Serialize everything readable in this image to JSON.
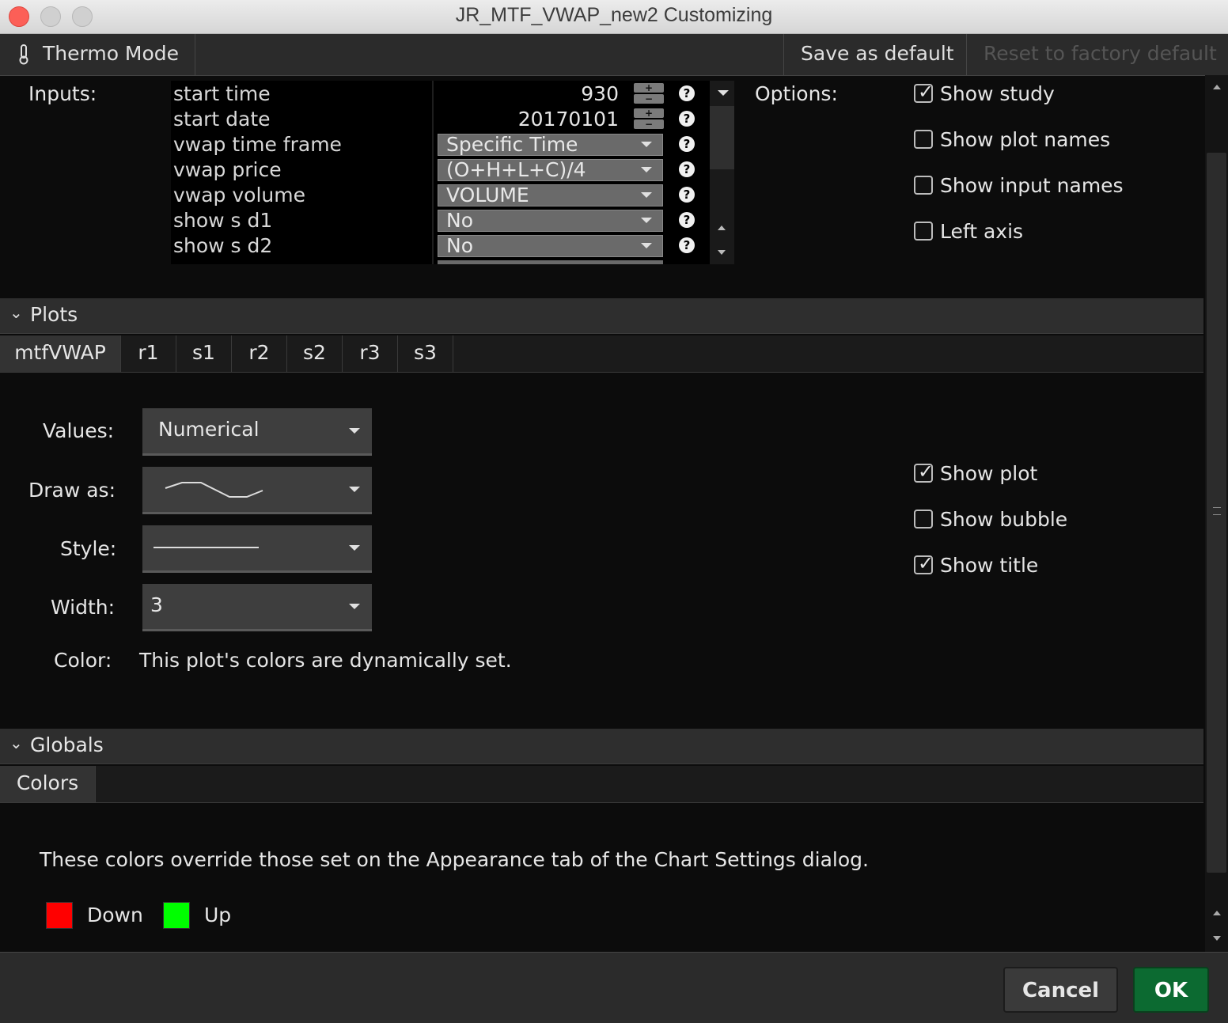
{
  "window": {
    "title": "JR_MTF_VWAP_new2 Customizing"
  },
  "toolbar": {
    "thermo_label": "Thermo Mode",
    "save_default_label": "Save as default",
    "reset_label": "Reset to factory default"
  },
  "inputs": {
    "section_label": "Inputs:",
    "rows": [
      {
        "name": "start time",
        "value": "930"
      },
      {
        "name": "start date",
        "value": "20170101"
      },
      {
        "name": "vwap time frame",
        "value": "Specific Time"
      },
      {
        "name": "vwap price",
        "value": "(O+H+L+C)/4"
      },
      {
        "name": "vwap volume",
        "value": "VOLUME"
      },
      {
        "name": "show s d1",
        "value": "No"
      },
      {
        "name": "show s d2",
        "value": "No"
      }
    ]
  },
  "options": {
    "section_label": "Options:",
    "items": [
      {
        "label": "Show study",
        "checked": true
      },
      {
        "label": "Show plot names",
        "checked": false
      },
      {
        "label": "Show input names",
        "checked": false
      },
      {
        "label": "Left axis",
        "checked": false
      }
    ]
  },
  "plots": {
    "section_label": "Plots",
    "tabs": [
      "mtfVWAP",
      "r1",
      "s1",
      "r2",
      "s2",
      "r3",
      "s3"
    ],
    "active_tab": "mtfVWAP",
    "values_label": "Values:",
    "values_value": "Numerical",
    "draw_as_label": "Draw as:",
    "style_label": "Style:",
    "width_label": "Width:",
    "width_value": "3",
    "color_label": "Color:",
    "color_text": "This plot's colors are dynamically set.",
    "checks": [
      {
        "label": "Show plot",
        "checked": true
      },
      {
        "label": "Show bubble",
        "checked": false
      },
      {
        "label": "Show title",
        "checked": true
      }
    ]
  },
  "globals": {
    "section_label": "Globals",
    "tab": "Colors",
    "description": "These colors override those set on the Appearance tab of the Chart Settings dialog.",
    "colors": [
      {
        "label": "Down",
        "color": "#ff0000"
      },
      {
        "label": "Up",
        "color": "#00ff00"
      }
    ]
  },
  "footer": {
    "cancel_label": "Cancel",
    "ok_label": "OK"
  }
}
